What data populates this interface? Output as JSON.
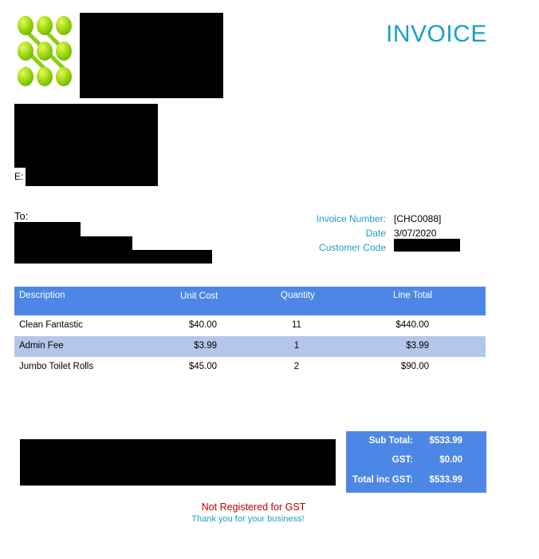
{
  "header": {
    "title": "INVOICE"
  },
  "sender": {
    "email_label": "E:"
  },
  "recipient": {
    "to_label": "To:"
  },
  "meta": {
    "invoice_number_label": "Invoice Number:",
    "invoice_number": "[CHC0088]",
    "date_label": "Date",
    "date": "3/07/2020",
    "customer_code_label": "Customer Code"
  },
  "table": {
    "headers": {
      "description": "Description",
      "unit_cost": "Unit Cost",
      "quantity": "Quantity",
      "line_total": "Line Total"
    },
    "rows": [
      {
        "description": "Clean Fantastic",
        "unit_cost": "$40.00",
        "quantity": "11",
        "line_total": "$440.00"
      },
      {
        "description": "Admin Fee",
        "unit_cost": "$3.99",
        "quantity": "1",
        "line_total": "$3.99"
      },
      {
        "description": "Jumbo Toilet Rolls",
        "unit_cost": "$45.00",
        "quantity": "2",
        "line_total": "$90.00"
      }
    ]
  },
  "totals": {
    "subtotal_label": "Sub Total:",
    "subtotal": "$533.99",
    "gst_label": "GST:",
    "gst": "$0.00",
    "total_label": "Total inc GST:",
    "total": "$533.99"
  },
  "footer": {
    "gst_note": "Not Registered for GST",
    "thanks": "Thank you for your business!"
  },
  "colors": {
    "accent": "#1aa0c8",
    "table_header": "#4d87e6",
    "alt_row": "#b4c7ea",
    "gst_note": "#c00000",
    "logo_green": "#8ed200"
  },
  "icons": {
    "logo": "green-dots-logo"
  }
}
